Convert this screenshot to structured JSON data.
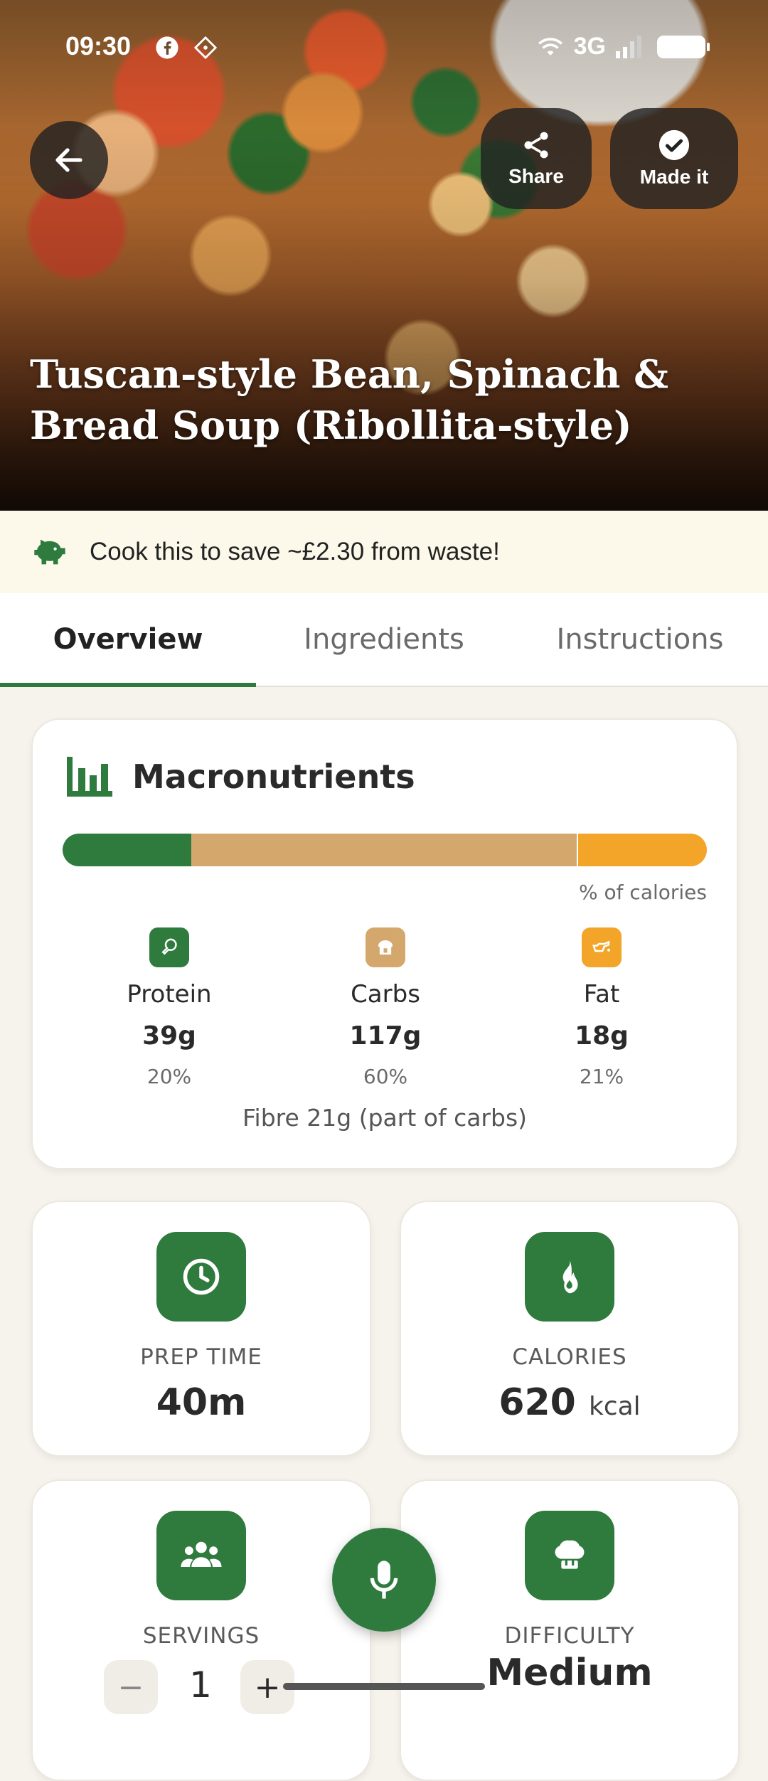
{
  "status_bar": {
    "time": "09:30",
    "network": "3G"
  },
  "hero": {
    "back_label": "Back",
    "share_label": "Share",
    "made_it_label": "Made it",
    "title_line1": "Tuscan-style Bean, Spinach &",
    "title_line2": "Bread Soup (Ribollita-style)"
  },
  "banner": {
    "text": "Cook this to save ~£2.30 from waste!"
  },
  "tabs": [
    {
      "label": "Overview",
      "active": true
    },
    {
      "label": "Ingredients",
      "active": false
    },
    {
      "label": "Instructions",
      "active": false
    }
  ],
  "macros": {
    "title": "Macronutrients",
    "caption": "% of calories",
    "bar_fractions": {
      "protein": 0.2,
      "carbs": 0.6,
      "fat": 0.2
    },
    "items": [
      {
        "name": "Protein",
        "amount": "39g",
        "percent": "20%",
        "color": "#2f7a3d"
      },
      {
        "name": "Carbs",
        "amount": "117g",
        "percent": "60%",
        "color": "#d4a86d"
      },
      {
        "name": "Fat",
        "amount": "18g",
        "percent": "21%",
        "color": "#f2a528"
      }
    ],
    "fibre_note": "Fibre 21g (part of carbs)"
  },
  "stats": {
    "prep_time": {
      "label": "PREP TIME",
      "value": "40m"
    },
    "calories": {
      "label": "CALORIES",
      "value": "620",
      "unit": "kcal"
    },
    "servings": {
      "label": "SERVINGS",
      "value": "1",
      "minus": "−",
      "plus": "+"
    },
    "difficulty": {
      "label": "DIFFICULTY",
      "value": "Medium"
    }
  },
  "colors": {
    "accent": "#2f7a3d",
    "banner_bg": "#fcf9ea",
    "page_bg": "#f6f3ec"
  },
  "icons": {
    "back": "arrow-left-icon",
    "share": "share-icon",
    "made_it": "check-circle-icon",
    "banner": "piggy-bank-icon",
    "macros": "bar-chart-icon",
    "prep": "clock-icon",
    "calories": "flame-icon",
    "servings": "people-icon",
    "difficulty": "chef-hat-icon",
    "fab": "microphone-icon"
  }
}
